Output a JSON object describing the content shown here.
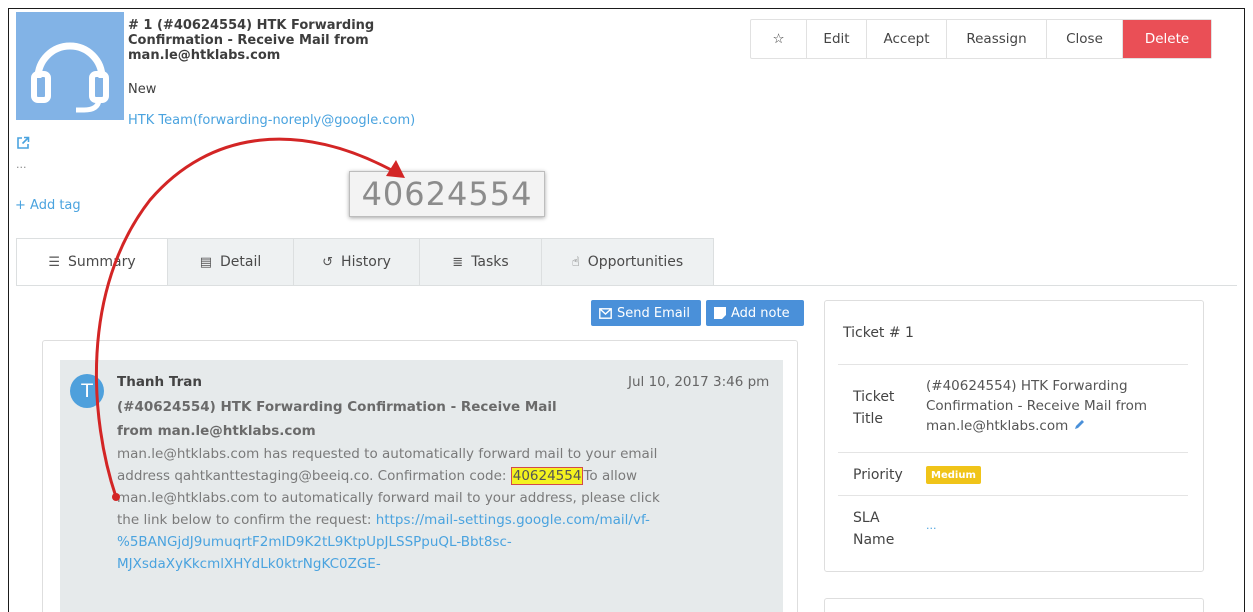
{
  "ticket": {
    "title": "# 1 (#40624554) HTK Forwarding Confirmation - Receive Mail from man.le@htklabs.com",
    "status": "New",
    "requester": "HTK Team(forwarding-noreply@google.com)",
    "ellipsis": "...",
    "add_tag": "+ Add tag"
  },
  "actions": {
    "star_icon": "☆",
    "edit": "Edit",
    "accept": "Accept",
    "reassign": "Reassign",
    "close": "Close",
    "delete": "Delete"
  },
  "callout": {
    "code": "40624554"
  },
  "tabs": [
    {
      "label": "Summary",
      "icon": "list-icon"
    },
    {
      "label": "Detail",
      "icon": "document-icon"
    },
    {
      "label": "History",
      "icon": "history-icon"
    },
    {
      "label": "Tasks",
      "icon": "tasks-icon"
    },
    {
      "label": "Opportunities",
      "icon": "hand-icon"
    }
  ],
  "buttons": {
    "send_email": "Send Email",
    "add_note": "Add note"
  },
  "message": {
    "avatar_initial": "T",
    "sender": "Thanh Tran",
    "date": "Jul 10, 2017 3:46 pm",
    "subject": "(#40624554) HTK Forwarding Confirmation - Receive Mail from man.le@htklabs.com",
    "body_intro": "man.le@htklabs.com has requested to automatically forward mail to your email address qahtkanttestaging@beeiq.co. Confirmation code:",
    "code": "40624554",
    "body_rest": "To allow man.le@htklabs.com to automatically forward mail to your address, please click the link below to confirm the request:",
    "link": "https://mail-settings.google.com/mail/vf-%5BANGjdJ9umuqrtF2mID9K2tL9KtpUpJLSSPpuQL-Bbt8sc-MJXsdaXyKkcmlXHYdLk0ktrNgKC0ZGE-"
  },
  "panel": {
    "title": "Ticket # 1",
    "ticket_title_label": "Ticket Title",
    "ticket_title_value": "(#40624554) HTK Forwarding Confirmation - Receive Mail from man.le@htklabs.com",
    "priority_label": "Priority",
    "priority_value": "Medium",
    "sla_label": "SLA Name",
    "sla_value": "..."
  },
  "colors": {
    "delete": "#ea4f56",
    "accent": "#4aa3df",
    "primary_button": "#4a90d9",
    "highlight": "#f4f21f",
    "priority_badge": "#f0c419",
    "arrow": "#d32525"
  }
}
